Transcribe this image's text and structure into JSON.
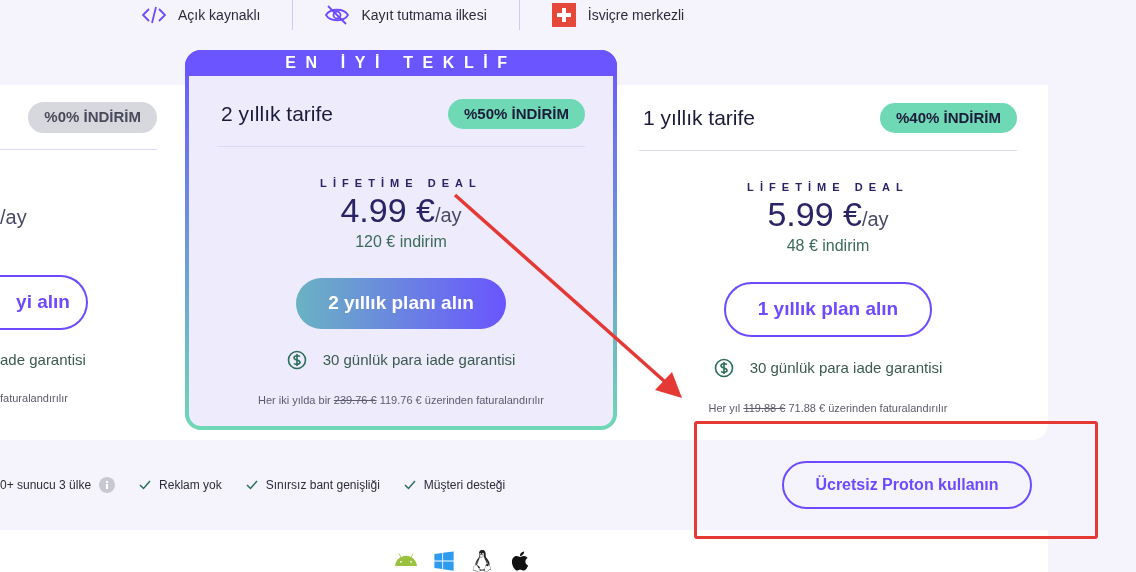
{
  "features": [
    {
      "kind": "code",
      "label": "Açık kaynaklı"
    },
    {
      "kind": "no-log",
      "label": "Kayıt tutmama ilkesi"
    },
    {
      "kind": "flag",
      "label": "İsviçre merkezli"
    }
  ],
  "plans": [
    {
      "kind": "partial",
      "featured": false,
      "badge": {
        "label": "%0% İNDİRİM",
        "color": "#d6d8de"
      },
      "price_unit": "/ay",
      "button": "yi alın",
      "guarantee": "ade garantisi",
      "billing_rest": "faturalandırılır"
    },
    {
      "kind": "full",
      "featured": true,
      "ribbon": "EN İYİ TEKLİF",
      "title": "2 yıllık tarife",
      "badge": {
        "label": "%50% İNDİRİM",
        "color": "#6fd8b5"
      },
      "deal": "LİFETİME DEAL",
      "price": "4.99 €",
      "price_unit": "/ay",
      "savings": "120 € indirim",
      "button": "2 yıllık planı alın",
      "guarantee": "30 günlük para iade garantisi",
      "billing_prefix": "Her iki yılda bir",
      "old_price": "239.76 €",
      "billing_rest": "119.76 € üzerinden faturalandırılır"
    },
    {
      "kind": "full",
      "featured": false,
      "title": "1 yıllık tarife",
      "badge": {
        "label": "%40% İNDİRİM",
        "color": "#6fd8b5"
      },
      "deal": "LİFETİME DEAL",
      "price": "5.99 €",
      "price_unit": "/ay",
      "savings": "48 € indirim",
      "button": "1 yıllık plan alın",
      "guarantee": "30 günlük para iade garantisi",
      "billing_prefix": "Her yıl",
      "old_price": "119.88 €",
      "billing_rest": "71.88 € üzerinden faturalandırılır"
    }
  ],
  "perks": [
    {
      "kind": "info",
      "label": "0+ sunucu 3 ülke"
    },
    {
      "kind": "check",
      "label": "Reklam yok"
    },
    {
      "kind": "check",
      "label": "Sınırsız bant genişliği"
    },
    {
      "kind": "check",
      "label": "Müşteri desteği"
    }
  ],
  "free_button": "Ücretsiz Proton kullanın",
  "platforms": [
    {
      "kind": "android"
    },
    {
      "kind": "windows"
    },
    {
      "kind": "linux"
    },
    {
      "kind": "apple"
    }
  ]
}
